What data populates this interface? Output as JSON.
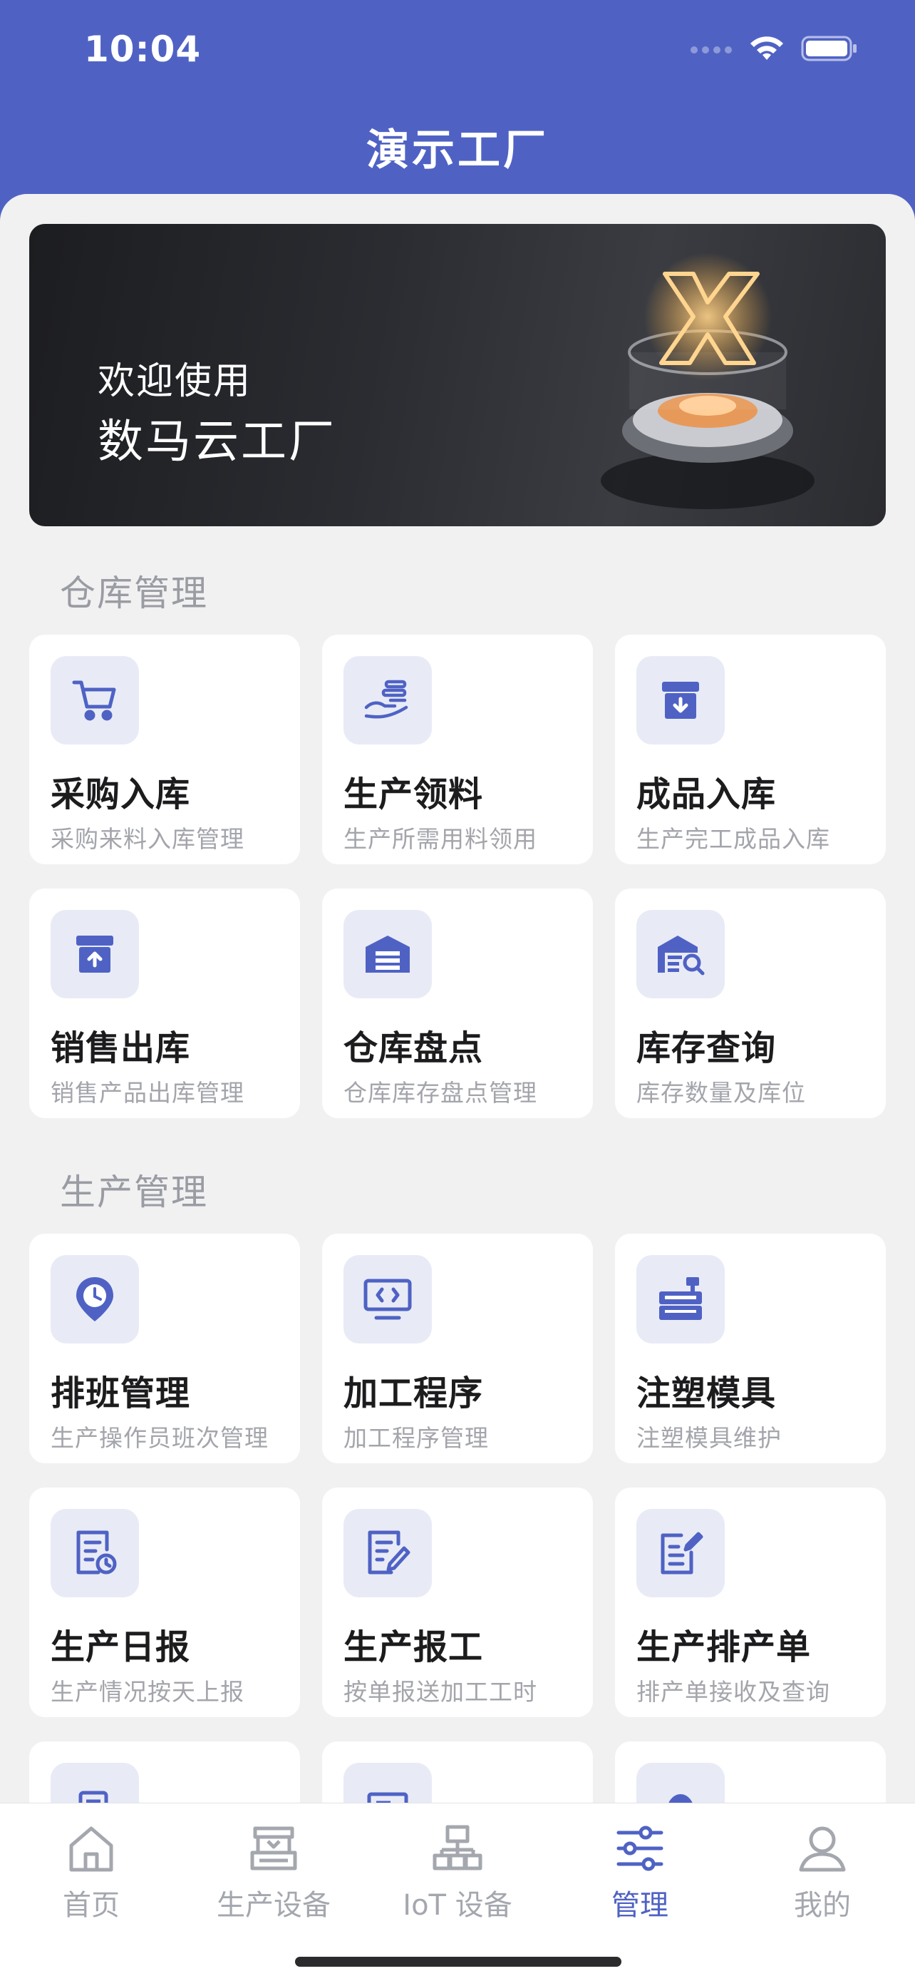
{
  "status": {
    "time": "10:04"
  },
  "nav": {
    "title": "演示工厂"
  },
  "banner": {
    "line1": "欢迎使用",
    "line2": "数马云工厂"
  },
  "sections": [
    {
      "title": "仓库管理",
      "cards": [
        {
          "title": "采购入库",
          "desc": "采购来料入库管理",
          "icon": "cart-icon"
        },
        {
          "title": "生产领料",
          "desc": "生产所需用料领用",
          "icon": "hand-coins-icon"
        },
        {
          "title": "成品入库",
          "desc": "生产完工成品入库",
          "icon": "box-in-icon"
        },
        {
          "title": "销售出库",
          "desc": "销售产品出库管理",
          "icon": "box-out-icon"
        },
        {
          "title": "仓库盘点",
          "desc": "仓库库存盘点管理",
          "icon": "warehouse-icon"
        },
        {
          "title": "库存查询",
          "desc": "库存数量及库位",
          "icon": "warehouse-search-icon"
        }
      ]
    },
    {
      "title": "生产管理",
      "cards": [
        {
          "title": "排班管理",
          "desc": "生产操作员班次管理",
          "icon": "clock-pin-icon"
        },
        {
          "title": "加工程序",
          "desc": "加工程序管理",
          "icon": "code-monitor-icon"
        },
        {
          "title": "注塑模具",
          "desc": "注塑模具维护",
          "icon": "machine-icon"
        },
        {
          "title": "生产日报",
          "desc": "生产情况按天上报",
          "icon": "report-icon"
        },
        {
          "title": "生产报工",
          "desc": "按单报送加工工时",
          "icon": "edit-doc-icon"
        },
        {
          "title": "生产排产单",
          "desc": "排产单接收及查询",
          "icon": "schedule-doc-icon"
        }
      ]
    }
  ],
  "tabs": [
    {
      "label": "首页",
      "icon": "home-icon"
    },
    {
      "label": "生产设备",
      "icon": "equipment-icon"
    },
    {
      "label": "IoT 设备",
      "icon": "iot-network-icon"
    },
    {
      "label": "管理",
      "icon": "sliders-icon"
    },
    {
      "label": "我的",
      "icon": "user-icon"
    }
  ],
  "colors": {
    "primary": "#4f62c4",
    "icon_bg": "#e8ebf6",
    "background": "#f1f1f2"
  }
}
